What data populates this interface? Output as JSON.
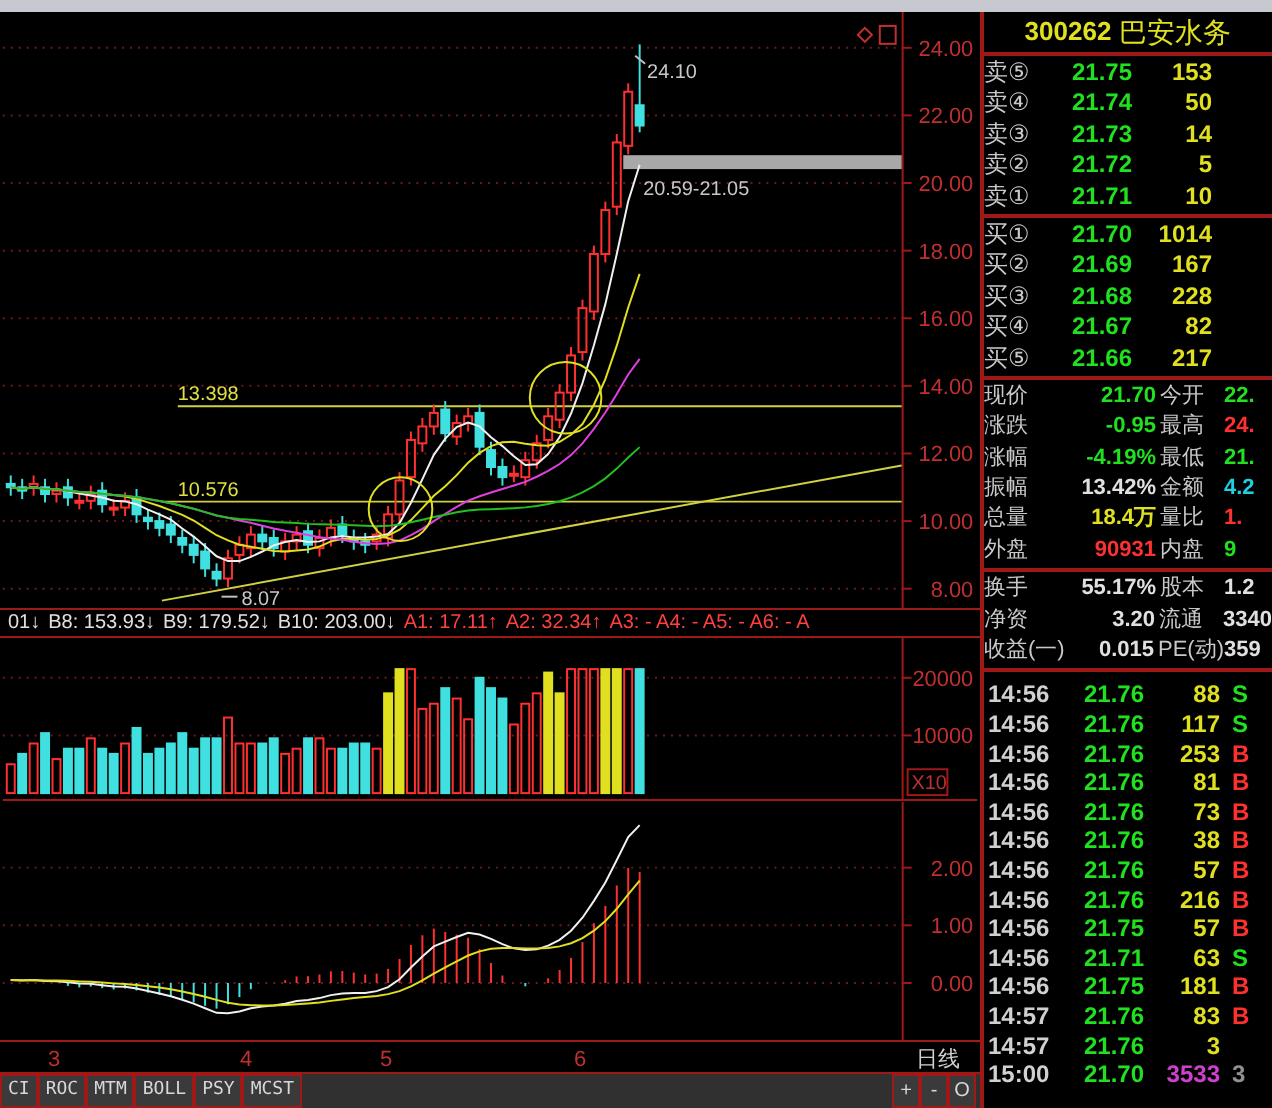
{
  "price_chart": {
    "y_labels": [
      "24.00",
      "22.00",
      "20.00",
      "18.00",
      "16.00",
      "14.00",
      "12.00",
      "10.00",
      "8.00"
    ],
    "annotations": [
      {
        "kind": "high",
        "text": "24.10"
      },
      {
        "kind": "range",
        "text": "20.59-21.05"
      },
      {
        "kind": "level",
        "text": "13.398"
      },
      {
        "kind": "level",
        "text": "10.576"
      },
      {
        "kind": "low",
        "text": "8.07"
      }
    ]
  },
  "indicator_strip": [
    {
      "text": "01↓",
      "color": "#e0e0e0"
    },
    {
      "text": "B8: 153.93↓",
      "color": "#e0e0e0"
    },
    {
      "text": "B9: 179.52↓",
      "color": "#e0e0e0"
    },
    {
      "text": "B10: 203.00↓",
      "color": "#e0e0e0"
    },
    {
      "text": "A1: 17.11↑",
      "color": "#ff4040"
    },
    {
      "text": "A2: 32.34↑",
      "color": "#ff4040"
    },
    {
      "text": "A3: - A4: - A5: - A6: - A",
      "color": "#ff4040"
    }
  ],
  "volume_panel": {
    "y_labels": [
      "20000",
      "10000"
    ],
    "multiplier": "X10"
  },
  "macd_panel": {
    "y_labels": [
      "2.00",
      "1.00",
      "0.00"
    ]
  },
  "date_axis": {
    "labels": [
      "3",
      "4",
      "5",
      "6"
    ],
    "period": "日线"
  },
  "indicator_tabs": [
    "CI",
    "ROC",
    "MTM",
    "BOLL",
    "PSY",
    "MCST"
  ],
  "zoom_buttons": [
    "+",
    "-",
    "O"
  ],
  "quote": {
    "code": "300262",
    "name": "巴安水务",
    "asks": [
      {
        "label": "卖⑤",
        "price": "21.75",
        "volume": "153"
      },
      {
        "label": "卖④",
        "price": "21.74",
        "volume": "50"
      },
      {
        "label": "卖③",
        "price": "21.73",
        "volume": "14"
      },
      {
        "label": "卖②",
        "price": "21.72",
        "volume": "5"
      },
      {
        "label": "卖①",
        "price": "21.71",
        "volume": "10"
      }
    ],
    "bids": [
      {
        "label": "买①",
        "price": "21.70",
        "volume": "1014"
      },
      {
        "label": "买②",
        "price": "21.69",
        "volume": "167"
      },
      {
        "label": "买③",
        "price": "21.68",
        "volume": "228"
      },
      {
        "label": "买④",
        "price": "21.67",
        "volume": "82"
      },
      {
        "label": "买⑤",
        "price": "21.66",
        "volume": "217"
      }
    ],
    "stats": [
      {
        "cells": [
          {
            "label": "现价",
            "value": "21.70",
            "color": "#20e020"
          },
          {
            "label": "今开",
            "value": "22.",
            "color": "#20e020"
          }
        ]
      },
      {
        "cells": [
          {
            "label": "涨跌",
            "value": "-0.95",
            "color": "#20e020"
          },
          {
            "label": "最高",
            "value": "24.",
            "color": "#ff3030"
          }
        ]
      },
      {
        "cells": [
          {
            "label": "涨幅",
            "value": "-4.19%",
            "color": "#20e020"
          },
          {
            "label": "最低",
            "value": "21.",
            "color": "#20e020"
          }
        ]
      },
      {
        "cells": [
          {
            "label": "振幅",
            "value": "13.42%",
            "color": "#e0e0e0"
          },
          {
            "label": "金额",
            "value": "4.2",
            "color": "#20d0e0"
          }
        ]
      },
      {
        "cells": [
          {
            "label": "总量",
            "value": "18.4万",
            "color": "#e0e020"
          },
          {
            "label": "量比",
            "value": "1.",
            "color": "#ff3030"
          }
        ]
      },
      {
        "cells": [
          {
            "label": "外盘",
            "value": "90931",
            "color": "#ff3030"
          },
          {
            "label": "内盘",
            "value": "9",
            "color": "#20e020"
          }
        ]
      }
    ],
    "stats_2": [
      {
        "cells": [
          {
            "label": "换手",
            "value": "55.17%",
            "color": "#e0e0e0"
          },
          {
            "label": "股本",
            "value": "1.2",
            "color": "#e0e0e0"
          }
        ]
      },
      {
        "cells": [
          {
            "label": "净资",
            "value": "3.20",
            "color": "#e0e0e0"
          },
          {
            "label": "流通",
            "value": "3340",
            "color": "#e0e0e0"
          }
        ]
      },
      {
        "cells": [
          {
            "label": "收益(一)",
            "value": "0.015",
            "color": "#e0e0e0"
          },
          {
            "label": "PE(动)",
            "value": "359",
            "color": "#e0e0e0"
          }
        ]
      }
    ]
  },
  "trades": [
    {
      "time": "14:56",
      "price": "21.76",
      "volume": "88",
      "side": "S",
      "kind": "sell"
    },
    {
      "time": "14:56",
      "price": "21.76",
      "volume": "117",
      "side": "S",
      "kind": "sell"
    },
    {
      "time": "14:56",
      "price": "21.76",
      "volume": "253",
      "side": "B",
      "kind": "buy"
    },
    {
      "time": "14:56",
      "price": "21.76",
      "volume": "81",
      "side": "B",
      "kind": "buy"
    },
    {
      "time": "14:56",
      "price": "21.76",
      "volume": "73",
      "side": "B",
      "kind": "buy"
    },
    {
      "time": "14:56",
      "price": "21.76",
      "volume": "38",
      "side": "B",
      "kind": "buy"
    },
    {
      "time": "14:56",
      "price": "21.76",
      "volume": "57",
      "side": "B",
      "kind": "buy"
    },
    {
      "time": "14:56",
      "price": "21.76",
      "volume": "216",
      "side": "B",
      "kind": "buy"
    },
    {
      "time": "14:56",
      "price": "21.75",
      "volume": "57",
      "side": "B",
      "kind": "buy"
    },
    {
      "time": "14:56",
      "price": "21.71",
      "volume": "63",
      "side": "S",
      "kind": "sell"
    },
    {
      "time": "14:56",
      "price": "21.75",
      "volume": "181",
      "side": "B",
      "kind": "buy"
    },
    {
      "time": "14:57",
      "price": "21.76",
      "volume": "83",
      "side": "B",
      "kind": "buy"
    },
    {
      "time": "14:57",
      "price": "21.76",
      "volume": "3",
      "kind": "neutral"
    },
    {
      "time": "15:00",
      "price": "21.70",
      "volume": "3533",
      "side": "3",
      "kind": "close"
    }
  ]
}
